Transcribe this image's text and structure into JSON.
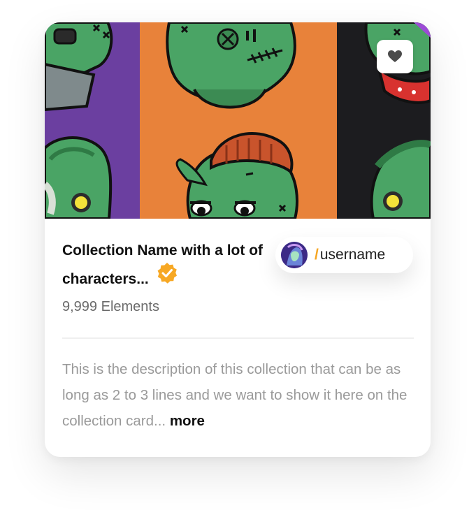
{
  "collection": {
    "title": "Collection Name with a lot of characters...",
    "verified_icon": "verified-badge-icon",
    "element_count": "9,999 Elements",
    "description": "This is the description of this collection that can be as long as 2 to 3 lines and we want to show it here on the collection card...",
    "more_label": "more"
  },
  "user": {
    "slash": "/",
    "username": "username",
    "avatar": "avatar-image"
  },
  "favorite": {
    "icon": "heart-icon"
  },
  "colors": {
    "accent": "#f6a623",
    "verified": "#f7a824",
    "panel_purple": "#6b3fa0",
    "panel_orange": "#e8823a",
    "panel_black": "#1c1c1f",
    "zombie_green": "#3e9a5a"
  }
}
